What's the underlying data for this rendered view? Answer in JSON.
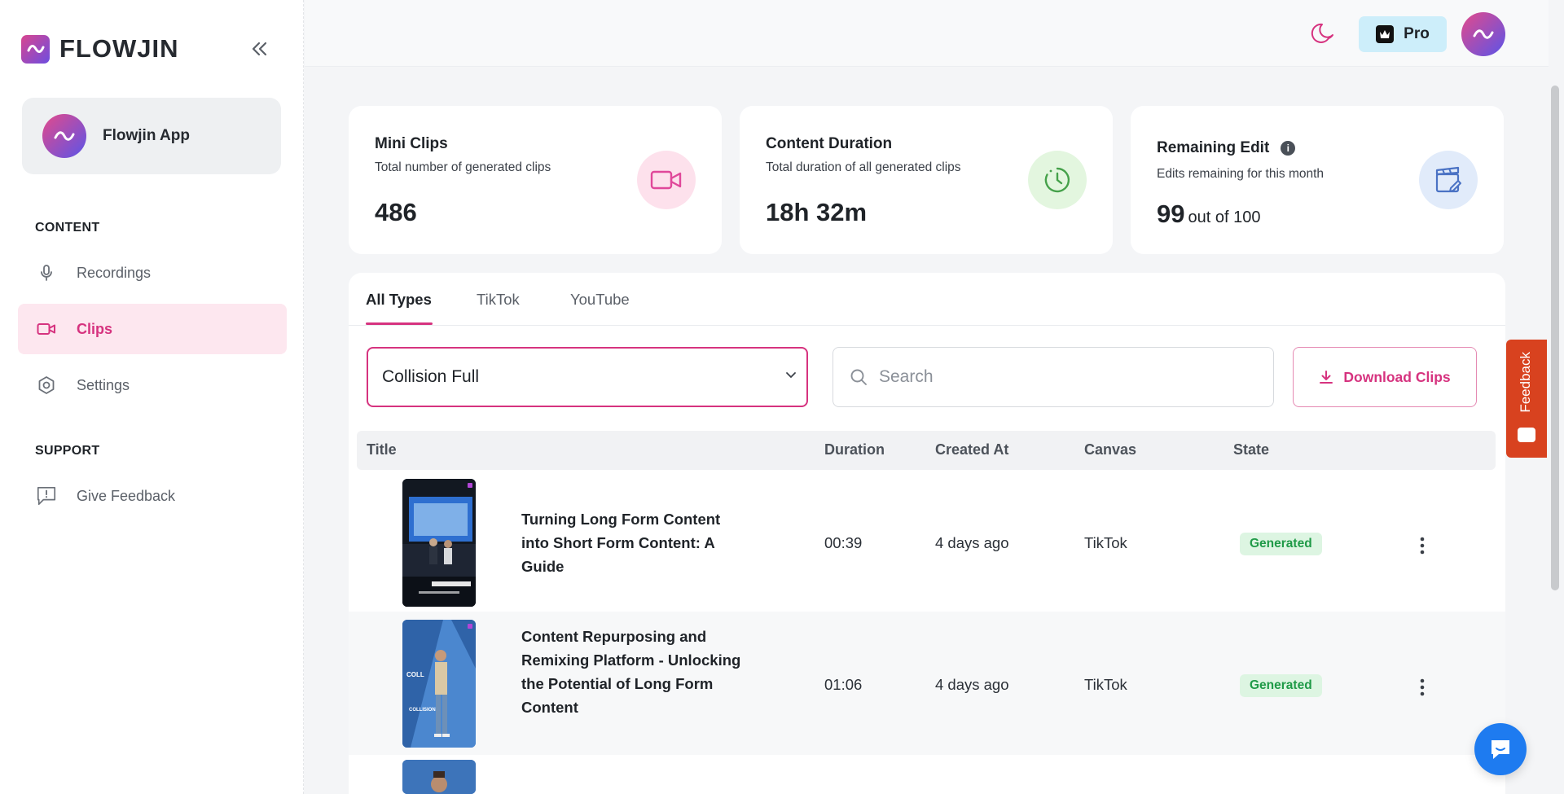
{
  "app": {
    "name": "FLOWJIN"
  },
  "workspace": {
    "name": "Flowjin App"
  },
  "sidebar": {
    "sections": [
      {
        "label": "CONTENT",
        "items": [
          {
            "label": "Recordings",
            "icon": "microphone-icon",
            "active": false
          },
          {
            "label": "Clips",
            "icon": "video-camera-icon",
            "active": true
          },
          {
            "label": "Settings",
            "icon": "settings-icon",
            "active": false
          }
        ]
      },
      {
        "label": "SUPPORT",
        "items": [
          {
            "label": "Give Feedback",
            "icon": "feedback-message-icon",
            "active": false
          }
        ]
      }
    ]
  },
  "header": {
    "pro_label": "Pro"
  },
  "stats": [
    {
      "title": "Mini Clips",
      "subtitle": "Total number of generated clips",
      "value": "486",
      "icon": "video-camera-icon",
      "color": "#fde1ec"
    },
    {
      "title": "Content Duration",
      "subtitle": "Total duration of all generated clips",
      "value": "18h 32m",
      "icon": "clock-icon",
      "color": "#e3f6df"
    },
    {
      "title": "Remaining Edit",
      "subtitle": "Edits remaining for this month",
      "value": "99",
      "value_suffix": "out of 100",
      "icon": "clapperboard-edit-icon",
      "color": "#e1ebfa",
      "info": "i"
    }
  ],
  "tabs": [
    "All Types",
    "TikTok",
    "YouTube"
  ],
  "filters": {
    "selected_recording": "Collision Full",
    "search_placeholder": "Search",
    "download_label": "Download Clips"
  },
  "table": {
    "columns": [
      "Title",
      "Duration",
      "Created At",
      "Canvas",
      "State"
    ],
    "rows": [
      {
        "title": "Turning Long Form Content into Short Form Content: A Guide",
        "duration": "00:39",
        "created_at": "4 days ago",
        "canvas": "TikTok",
        "state": "Generated"
      },
      {
        "title": "Content Repurposing and Remixing Platform - Unlocking the Potential of Long Form Content",
        "duration": "01:06",
        "created_at": "4 days ago",
        "canvas": "TikTok",
        "state": "Generated"
      }
    ]
  },
  "feedback_tab": {
    "label": "Feedback"
  },
  "colors": {
    "accent": "#d6337f",
    "success": "#1f9a47",
    "feedback": "#d8421f",
    "chat": "#1e7bf0"
  }
}
